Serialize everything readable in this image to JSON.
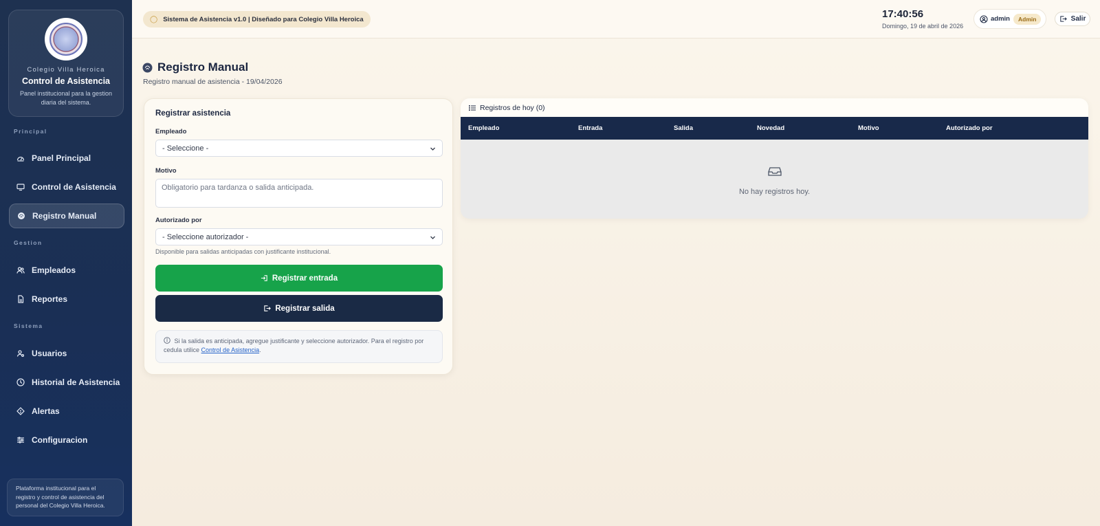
{
  "sidebar": {
    "school": "Colegio Villa Heroica",
    "title": "Control de Asistencia",
    "description": "Panel institucional para la gestion diaria del sistema.",
    "sections": {
      "principal": "Principal",
      "gestion": "Gestion",
      "sistema": "Sistema"
    },
    "items": [
      {
        "label": "Panel Principal",
        "icon": "dashboard-icon"
      },
      {
        "label": "Control de Asistencia",
        "icon": "monitor-icon"
      },
      {
        "label": "Registro Manual",
        "icon": "fingerprint-icon",
        "active": true
      },
      {
        "label": "Empleados",
        "icon": "users-icon"
      },
      {
        "label": "Reportes",
        "icon": "report-icon"
      },
      {
        "label": "Usuarios",
        "icon": "user-cog-icon"
      },
      {
        "label": "Historial de Asistencia",
        "icon": "clock-icon"
      },
      {
        "label": "Alertas",
        "icon": "alert-icon"
      },
      {
        "label": "Configuracion",
        "icon": "sliders-icon"
      }
    ],
    "footer": "Plataforma institucional para el registro y control de asistencia del personal del Colegio Villa Heroica."
  },
  "topbar": {
    "version": "Sistema de Asistencia v1.0 | Diseñado para Colegio Villa Heroica",
    "clock": "17:40:56",
    "date": "Domingo, 19 de abril de 2026",
    "user": "admin",
    "role": "Admin",
    "logout": "Salir"
  },
  "page": {
    "title": "Registro Manual",
    "subtitle": "Registro manual de asistencia - 19/04/2026"
  },
  "form": {
    "title": "Registrar asistencia",
    "employee_label": "Empleado",
    "employee_value": "- Seleccione -",
    "reason_label": "Motivo",
    "reason_placeholder": "Obligatorio para tardanza o salida anticipada.",
    "authorized_label": "Autorizado por",
    "authorized_value": "- Seleccione autorizador -",
    "hint": "Disponible para salidas anticipadas con justificante institucional.",
    "entry_button": "Registrar entrada",
    "exit_button": "Registrar salida",
    "info_text": "Si la salida es anticipada, agregue justificante y seleccione autorizador. Para el registro por cedula utilice",
    "info_link": "Control de Asistencia",
    "info_end": "."
  },
  "records": {
    "title": "Registros de hoy (0)",
    "columns": [
      "Empleado",
      "Entrada",
      "Salida",
      "Novedad",
      "Motivo",
      "Autorizado por"
    ],
    "empty": "No hay registros hoy."
  },
  "colors": {
    "sidebar": "#1e3150",
    "accent_green": "#17a34a",
    "navy": "#1a2a45",
    "badge": "#f6e9cb"
  }
}
